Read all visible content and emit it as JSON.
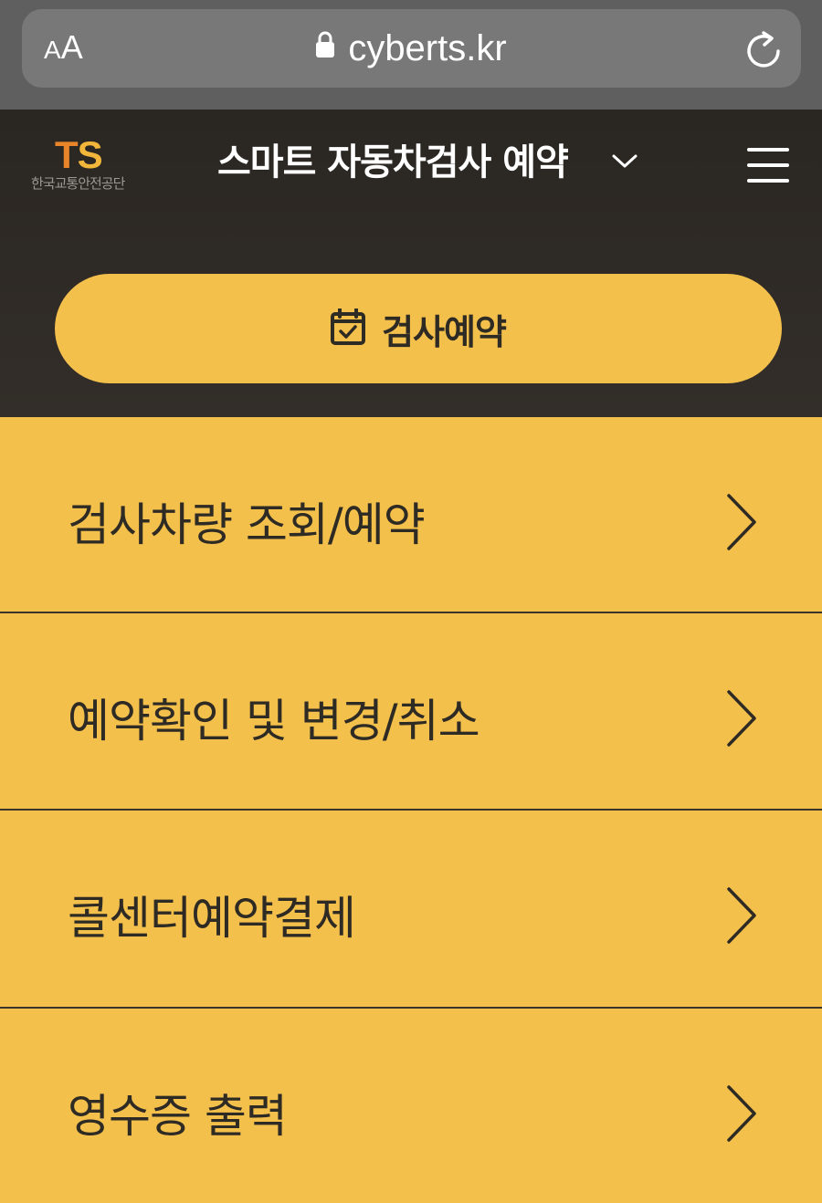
{
  "browser": {
    "aa_label_small": "A",
    "aa_label_large": "A",
    "url": "cyberts.kr",
    "lock_icon": "lock-icon",
    "reload_icon": "reload-icon"
  },
  "header": {
    "logo_mark_t": "T",
    "logo_mark_s": "S",
    "logo_subtitle": "한국교통안전공단",
    "service_title": "스마트 자동차검사 예약",
    "dropdown_icon": "chevron-down-icon",
    "menu_icon": "hamburger-menu-icon",
    "reserve_button_label": "검사예약",
    "reserve_icon": "calendar-check-icon"
  },
  "menu": {
    "items": [
      {
        "label": "검사차량 조회/예약",
        "icon": "chevron-right-icon"
      },
      {
        "label": "예약확인 및 변경/취소",
        "icon": "chevron-right-icon"
      },
      {
        "label": "콜센터예약결제",
        "icon": "chevron-right-icon"
      },
      {
        "label": "영수증 출력",
        "icon": "chevron-right-icon"
      }
    ]
  },
  "colors": {
    "accent_yellow": "#f4c04c",
    "header_dark": "#2f2b27",
    "text_dark": "#2e2a24",
    "logo_orange": "#e8842a"
  }
}
